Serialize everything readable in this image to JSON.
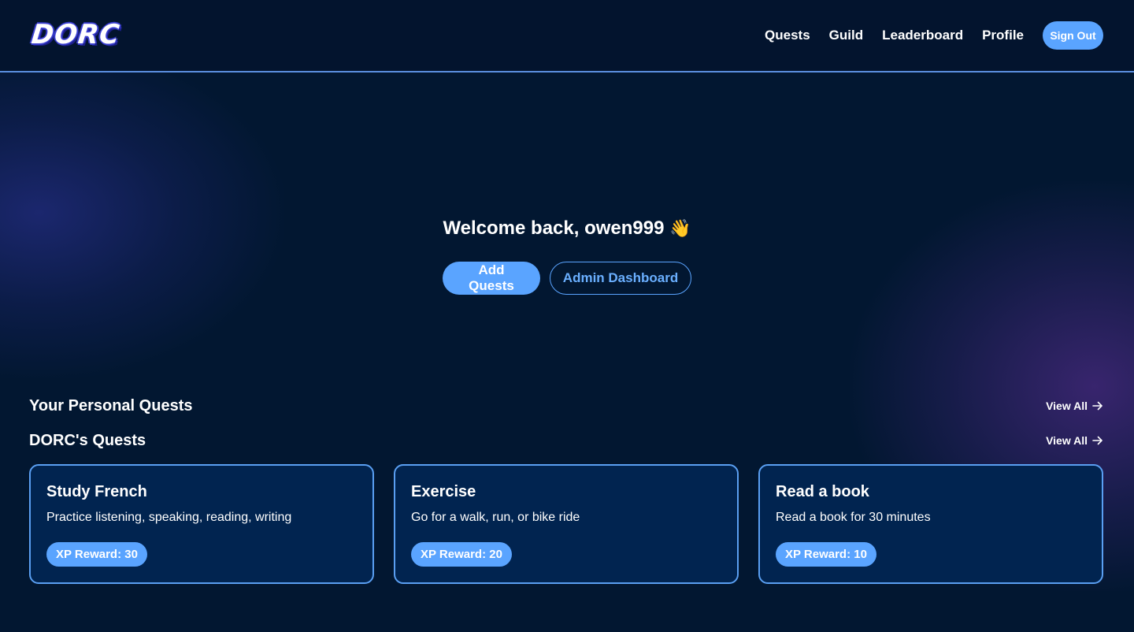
{
  "header": {
    "logo_text": "DORC",
    "nav": [
      {
        "label": "Quests"
      },
      {
        "label": "Guild"
      },
      {
        "label": "Leaderboard"
      },
      {
        "label": "Profile"
      }
    ],
    "sign_out_label": "Sign Out"
  },
  "hero": {
    "welcome_prefix": "Welcome back, ",
    "username": "owen999",
    "wave_emoji": "👋",
    "add_quests_label": "Add Quests",
    "admin_dashboard_label": "Admin Dashboard"
  },
  "sections": {
    "personal": {
      "title": "Your Personal Quests",
      "view_all": "View All"
    },
    "dorc": {
      "title": "DORC's Quests",
      "view_all": "View All"
    }
  },
  "quests": [
    {
      "title": "Study French",
      "description": "Practice listening, speaking, reading, writing",
      "xp_label": "XP Reward: 30"
    },
    {
      "title": "Exercise",
      "description": "Go for a walk, run, or bike ride",
      "xp_label": "XP Reward: 20"
    },
    {
      "title": "Read a book",
      "description": "Read a book for 30 minutes",
      "xp_label": "XP Reward: 10"
    }
  ],
  "colors": {
    "background": "#021731",
    "accent": "#5aa4ff",
    "card_bg": "#012450",
    "card_border": "#5a9ff2"
  }
}
